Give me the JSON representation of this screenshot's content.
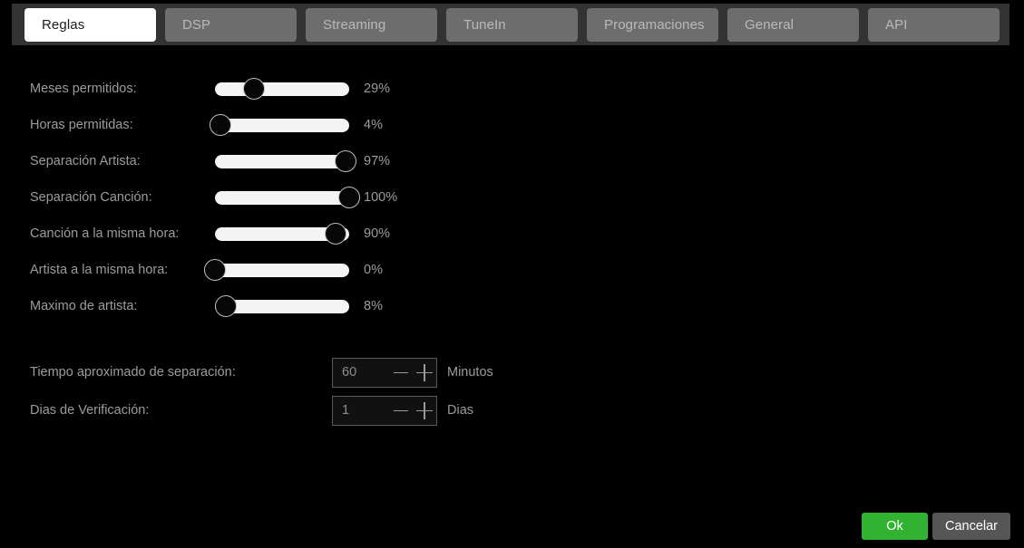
{
  "window": {
    "background": "#000000",
    "tabbar_background": "#333333"
  },
  "tabs": [
    {
      "label": "Reglas",
      "active": true
    },
    {
      "label": "DSP",
      "active": false
    },
    {
      "label": "Streaming",
      "active": false
    },
    {
      "label": "TuneIn",
      "active": false
    },
    {
      "label": "Programaciones",
      "active": false
    },
    {
      "label": "General",
      "active": false
    },
    {
      "label": "API",
      "active": false
    }
  ],
  "sliders": [
    {
      "label": "Meses permitidos:",
      "value": 29,
      "value_text": "29%"
    },
    {
      "label": "Horas permitidas:",
      "value": 4,
      "value_text": "4%"
    },
    {
      "label": "Separación Artista:",
      "value": 97,
      "value_text": "97%"
    },
    {
      "label": "Separación Canción:",
      "value": 100,
      "value_text": "100%"
    },
    {
      "label": "Canción a la misma hora:",
      "value": 90,
      "value_text": "90%"
    },
    {
      "label": "Artista a la misma hora:",
      "value": 0,
      "value_text": "0%"
    },
    {
      "label": "Maximo de artista:",
      "value": 8,
      "value_text": "8%"
    }
  ],
  "steppers": [
    {
      "label": "Tiempo aproximado de separación:",
      "value": "60",
      "unit": "Minutos",
      "minus": "minus-icon",
      "plus": "plus-icon"
    },
    {
      "label": "Dias de Verificación:",
      "value": "1",
      "unit": "Dias",
      "minus": "minus-icon",
      "plus": "plus-icon"
    }
  ],
  "footer": {
    "ok_label": "Ok",
    "cancel_label": "Cancelar",
    "ok_color": "#32b231",
    "cancel_color": "#565656"
  }
}
